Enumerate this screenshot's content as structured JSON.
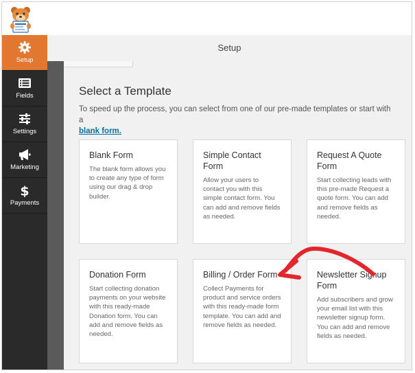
{
  "header": {
    "title": "Setup"
  },
  "sidebar": {
    "items": [
      {
        "label": "Setup",
        "icon": "gear-icon"
      },
      {
        "label": "Fields",
        "icon": "list-icon"
      },
      {
        "label": "Settings",
        "icon": "sliders-icon"
      },
      {
        "label": "Marketing",
        "icon": "megaphone-icon"
      },
      {
        "label": "Payments",
        "icon": "dollar-icon"
      }
    ]
  },
  "main": {
    "heading": "Select a Template",
    "intro": "To speed up the process, you can select from one of our pre-made templates or start with a",
    "intro_link": "blank form.",
    "templates": [
      {
        "title": "Blank Form",
        "description": "The blank form allows you to create any type of form using our drag & drop builder."
      },
      {
        "title": "Simple Contact Form",
        "description": "Allow your users to contact you with this simple contact form. You can add and remove fields as needed."
      },
      {
        "title": "Request A Quote Form",
        "description": "Start collecting leads with this pre-made Request a quote form. You can add and remove fields as needed."
      },
      {
        "title": "Donation Form",
        "description": "Start collecting donation payments on your website with this ready-made Donation form. You can add and remove fields as needed."
      },
      {
        "title": "Billing / Order Form",
        "description": "Collect Payments for product and service orders with this ready-made form template. You can add and remove fields as needed."
      },
      {
        "title": "Newsletter Signup Form",
        "description": "Add subscribers and grow your email list with this newsletter signup form. You can add and remove fields as needed."
      }
    ]
  },
  "colors": {
    "accent": "#e27730",
    "sidebar": "#2a2a2a",
    "link": "#0b6fa4",
    "annotation_arrow": "#e3262b"
  }
}
